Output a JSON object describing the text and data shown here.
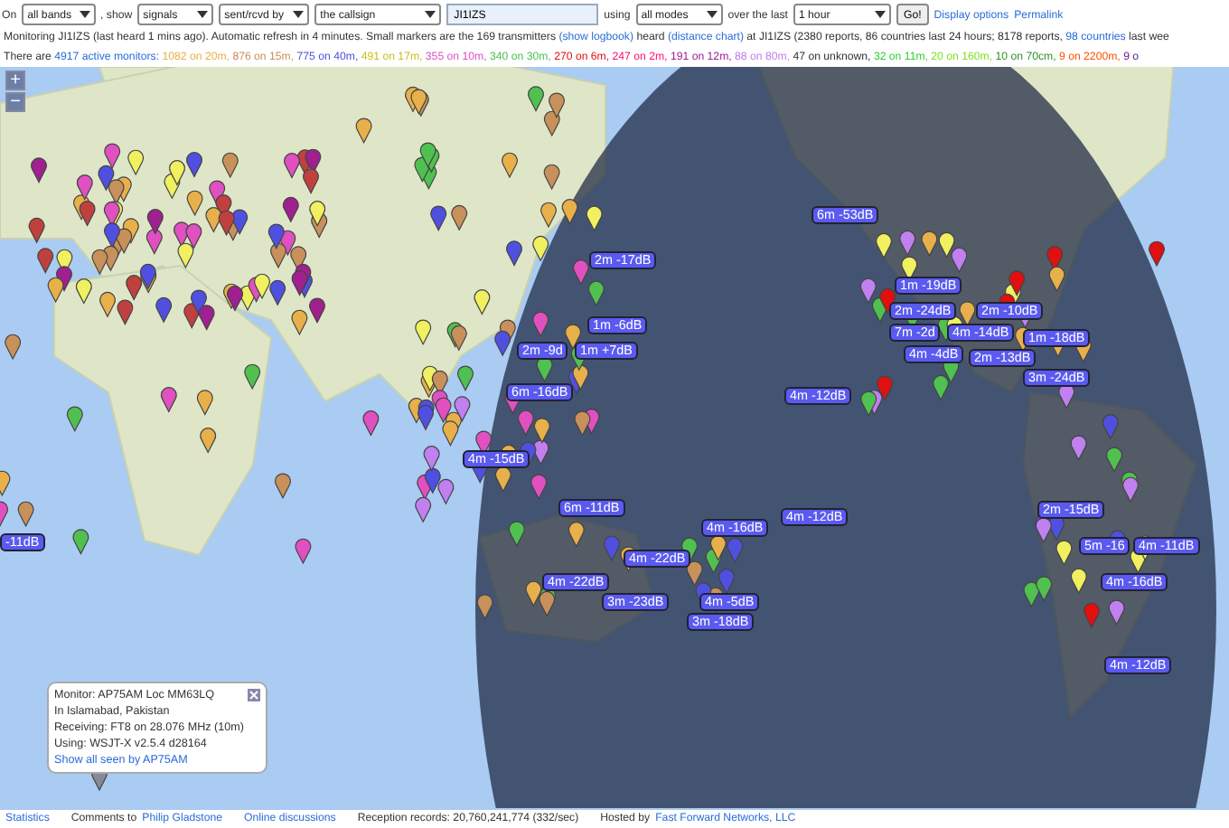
{
  "toolbar": [
    {
      "kind": "text",
      "text": "On"
    },
    {
      "kind": "select",
      "text": "all bands"
    },
    {
      "kind": "text",
      "text": ", show"
    },
    {
      "kind": "select",
      "text": "signals"
    },
    {
      "kind": "select",
      "text": "sent/rcvd by"
    },
    {
      "kind": "select",
      "text": "the callsign"
    },
    {
      "kind": "input",
      "text": "JI1IZS"
    },
    {
      "kind": "text",
      "text": "using"
    },
    {
      "kind": "select",
      "text": "all modes"
    },
    {
      "kind": "text",
      "text": "over the last"
    },
    {
      "kind": "select",
      "text": "1 hour"
    },
    {
      "kind": "button",
      "text": "Go!"
    },
    {
      "kind": "link",
      "text": "Display options"
    },
    {
      "kind": "link",
      "text": "Permalink"
    }
  ],
  "status_line": [
    {
      "kind": "text",
      "text": "Monitoring JI1IZS (last heard 1 mins ago). Automatic refresh in 4 minutes. Small markers are the 169 transmitters"
    },
    {
      "kind": "link",
      "text": "(show logbook)"
    },
    {
      "kind": "text",
      "text": "heard"
    },
    {
      "kind": "link",
      "text": "(distance chart)"
    },
    {
      "kind": "text",
      "text": "at JI1IZS (2380 reports, 86 countries last 24 hours; 8178 reports,"
    },
    {
      "kind": "link",
      "text": "98 countries"
    },
    {
      "kind": "text",
      "text": "last wee"
    }
  ],
  "monitors_line": [
    {
      "kind": "text",
      "text": "There are"
    },
    {
      "kind": "link",
      "text": "4917 active monitors:"
    },
    {
      "kind": "band",
      "text": "1082 on 20m,",
      "color": "#e8b04a"
    },
    {
      "kind": "band",
      "text": "876 on 15m,",
      "color": "#c8905a"
    },
    {
      "kind": "band",
      "text": "775 on 40m,",
      "color": "#5050e0"
    },
    {
      "kind": "band",
      "text": "491 on 17m,",
      "color": "#c8c020"
    },
    {
      "kind": "band",
      "text": "355 on 10m,",
      "color": "#e050c0"
    },
    {
      "kind": "band",
      "text": "340 on 30m,",
      "color": "#50c050"
    },
    {
      "kind": "band",
      "text": "270 on 6m,",
      "color": "#e01010"
    },
    {
      "kind": "band",
      "text": "247 on 2m,",
      "color": "#ff1070"
    },
    {
      "kind": "band",
      "text": "191 on 12m,",
      "color": "#a02090"
    },
    {
      "kind": "band",
      "text": "88 on 80m,",
      "color": "#c080f0"
    },
    {
      "kind": "text",
      "text": "47 on unknown,"
    },
    {
      "kind": "band",
      "text": "32 on 11m,",
      "color": "#30d030"
    },
    {
      "kind": "band",
      "text": "20 on 160m,",
      "color": "#80e020"
    },
    {
      "kind": "band",
      "text": "10 on 70cm,",
      "color": "#309030"
    },
    {
      "kind": "band",
      "text": "9 on 2200m,",
      "color": "#ff5000"
    },
    {
      "kind": "band",
      "text": "9 o",
      "color": "#602080"
    }
  ],
  "map": {
    "zoom_controls": [
      "+",
      "−"
    ],
    "reports": [
      "6m -53dB",
      "2m -17dB",
      "1m -19dB",
      "2m -24dB",
      "2m -10dB",
      "1m -6dB",
      "7m -2d",
      "4m -14dB",
      "1m -18dB",
      "2m -9d",
      "1m +7dB",
      "4m -4dB",
      "2m -13dB",
      "3m -24dB",
      "6m -16dB",
      "4m -12dB",
      "4m -15dB",
      "6m -11dB",
      "2m -15dB",
      "4m -12dB",
      "4m -16dB",
      "-11dB",
      "5m -16",
      "4m -11dB",
      "4m -22dB",
      "4m -22dB",
      "4m -16dB",
      "3m -23dB",
      "4m -5dB",
      "3m -18dB",
      "4m -12dB"
    ],
    "popup": {
      "lines": [
        "Monitor: AP75AM Loc MM63LQ",
        "In Islamabad, Pakistan",
        "Receiving: FT8 on 28.076 MHz (10m)",
        "Using: WSJT-X v2.5.4 d28164"
      ],
      "link": "Show all seen by AP75AM"
    }
  },
  "footer": [
    {
      "kind": "link",
      "text": "Statistics"
    },
    {
      "kind": "text",
      "text": "Comments to"
    },
    {
      "kind": "link",
      "text": "Philip Gladstone"
    },
    {
      "kind": "link",
      "text": "Online discussions"
    },
    {
      "kind": "text",
      "text": "Reception records: 20,760,241,774 (332/sec)"
    },
    {
      "kind": "text",
      "text": "Hosted by"
    },
    {
      "kind": "link",
      "text": "Fast Forward Networks, LLC"
    }
  ]
}
